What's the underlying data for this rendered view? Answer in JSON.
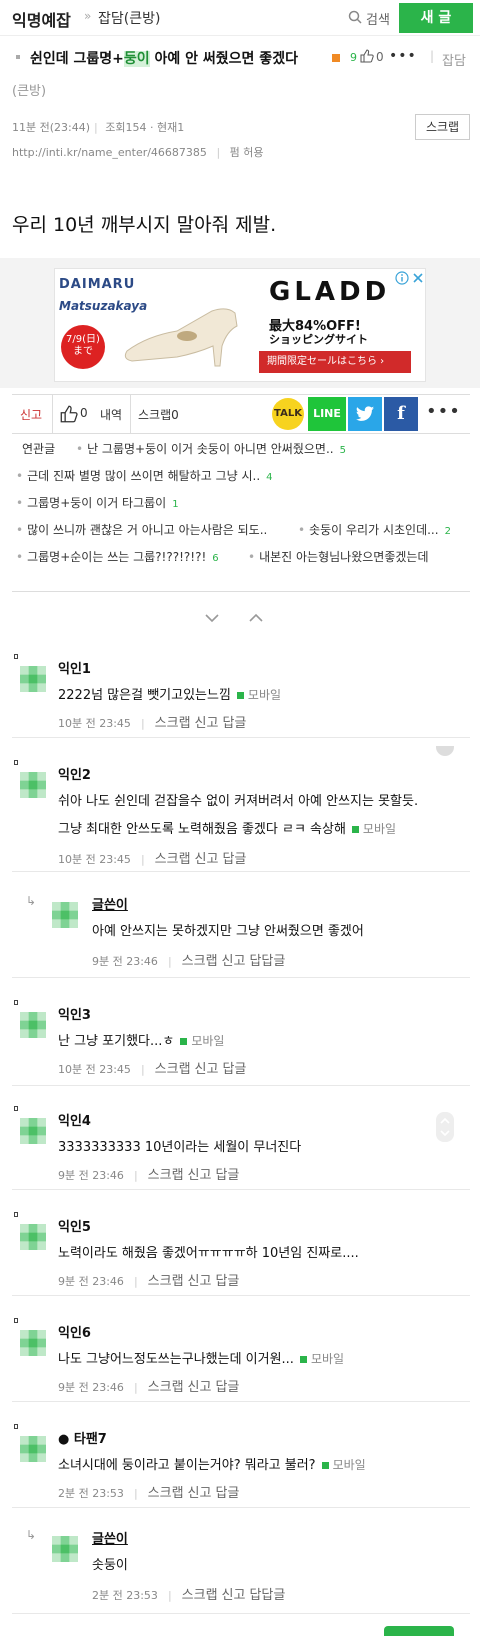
{
  "header": {
    "site_name": "익명예잡",
    "separator": "»",
    "board_name": "잡담(큰방)",
    "search_label": "검색",
    "new_post_label": "새 글"
  },
  "post": {
    "title_pre": "쉰인데 그룹명+",
    "title_hl": "둥이",
    "title_post": " 아예 안 써줬으면 좋겠다",
    "like_count": "9",
    "dislike_count": "0",
    "category_a": "잡담",
    "category_b": "(큰방)",
    "time": "11분 전(23:44)",
    "views": "조회154 · 현재1",
    "url": "http://inti.kr/name_enter/46687385",
    "permission": "펌 허용",
    "scrap_button": "스크랩",
    "body": "우리 10년 깨부시지 말아줘 제발."
  },
  "ad": {
    "brand1": "DAIMARU",
    "brand2": "Matsuzakaya",
    "date_badge": "7/9(日)",
    "date_badge_sub": "まで",
    "headline": "GLADD",
    "offer": "最大84%OFF!",
    "tagline": "ショッピングサイト",
    "cta": "期間限定セールはこちら ›"
  },
  "actions": {
    "report": "신고",
    "like_count": "0",
    "detail": "내역",
    "scrap": "스크랩0",
    "kakao": "TALK",
    "line": "LINE",
    "twitter": "t",
    "facebook": "f",
    "more": "•••"
  },
  "related": {
    "label": "연관글",
    "items": [
      {
        "text": "난 그룹명+둥이 이거 솟둥이 아니면 안써줬으면..",
        "count": "5"
      },
      {
        "text": "근데 진짜 별명 많이 쓰이면 해탈하고 그냥 시..",
        "count": "4"
      },
      {
        "text": "그룹명+둥이 이거 타그룹이",
        "count": "1"
      },
      {
        "text": "많이 쓰니까 괜찮은 거 아니고 아는사람은 되도..",
        "count": ""
      },
      {
        "text": "솟둥이 우리가 시초인데...",
        "count": "2"
      },
      {
        "text": "그룹명+순이는 쓰는 그룹?!??!?!?!",
        "count": "6"
      },
      {
        "text": "내본진 아는형님나왔으면좋겠는데",
        "count": ""
      }
    ]
  },
  "comments": [
    {
      "name": "익인1",
      "text": "2222넘 많은걸 뺏기고있는느낌",
      "mobile": "모바일",
      "time": "10분 전 23:45",
      "scrap": "스크랩",
      "report": "신고",
      "reply": "답글"
    },
    {
      "name": "익인2",
      "text": "쉬아 나도 쉰인데 걷잡을수 없이 커져버려서 아예 안쓰지는 못할듯.",
      "text2": "그냥 최대한 안쓰도록 노력해줬음 좋겠다 ㄹㅋ 속상해",
      "mobile": "모바일",
      "time": "10분 전 23:45",
      "scrap": "스크랩",
      "report": "신고",
      "reply": "답글"
    },
    {
      "name": "글쓴이",
      "text": "아예 안쓰지는 못하겠지만 그냥 안써줬으면 좋겠어",
      "time": "9분 전 23:46",
      "scrap": "스크랩",
      "report": "신고",
      "reply": "답답글"
    },
    {
      "name": "익인3",
      "text": "난 그냥 포기했다...ㅎ",
      "mobile": "모바일",
      "time": "10분 전 23:45",
      "scrap": "스크랩",
      "report": "신고",
      "reply": "답글"
    },
    {
      "name": "익인4",
      "text": "3333333333 10년이라는 세월이 무너진다",
      "time": "9분 전 23:46",
      "scrap": "스크랩",
      "report": "신고",
      "reply": "답글"
    },
    {
      "name": "익인5",
      "text": "노력이라도 해줬음 좋겠어ㅠㅠㅠㅠ하 10년임 진짜로....",
      "time": "9분 전 23:46",
      "scrap": "스크랩",
      "report": "신고",
      "reply": "답글"
    },
    {
      "name": "익인6",
      "text": "나도 그냥어느정도쓰는구나했는데 이거원...",
      "mobile": "모바일",
      "time": "9분 전 23:46",
      "scrap": "스크랩",
      "report": "신고",
      "reply": "답글"
    },
    {
      "name": "● 타팬7",
      "text": "소녀시대에 둥이라고 붙이는거야? 뭐라고 불러?",
      "mobile": "모바일",
      "time": "2분 전 23:53",
      "scrap": "스크랩",
      "report": "신고",
      "reply": "답글"
    },
    {
      "name": "글쓴이",
      "text": "솟둥이",
      "time": "2분 전 23:53",
      "scrap": "스크랩",
      "report": "신고",
      "reply": "답답글"
    }
  ],
  "colors": {
    "accent": "#2bb44a",
    "avatar_light": "#bfe8c8",
    "avatar_mid": "#7fd394",
    "avatar_dark": "#4cc066"
  }
}
